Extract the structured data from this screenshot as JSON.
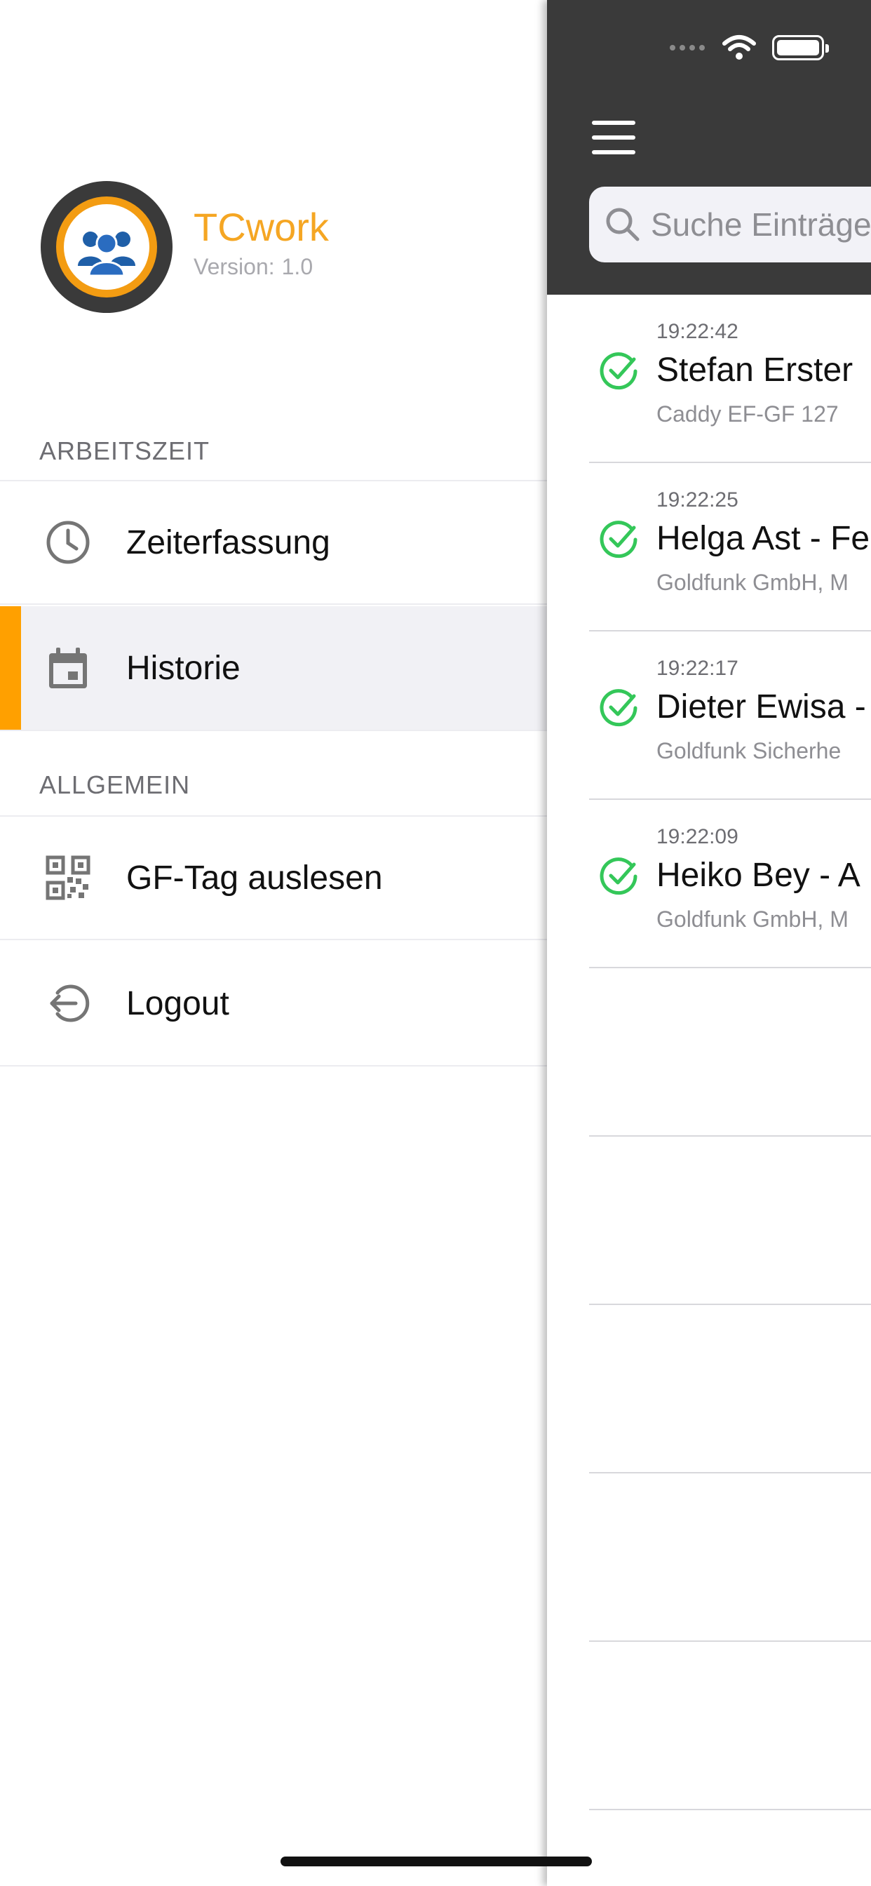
{
  "app": {
    "title": "TCwork",
    "version_label": "Version:",
    "version_value": "1.0",
    "accent_color": "#ffa000",
    "brand_color": "#f5a623"
  },
  "drawer": {
    "sections": [
      {
        "title": "ARBEITSZEIT",
        "items": [
          {
            "label": "Zeiterfassung",
            "icon": "clock-icon",
            "active": false
          },
          {
            "label": "Historie",
            "icon": "calendar-icon",
            "active": true
          }
        ]
      },
      {
        "title": "ALLGEMEIN",
        "items": [
          {
            "label": "GF-Tag auslesen",
            "icon": "qr-code-icon",
            "active": false
          },
          {
            "label": "Logout",
            "icon": "logout-icon",
            "active": false
          }
        ]
      }
    ]
  },
  "main": {
    "search_placeholder": "Suche Einträge",
    "entries": [
      {
        "time": "19:22:42",
        "name": "Stefan Erster",
        "sub": "Caddy EF-GF 127",
        "status": "check-icon"
      },
      {
        "time": "19:22:25",
        "name": "Helga Ast - Fe",
        "sub": "Goldfunk GmbH, M",
        "status": "check-icon"
      },
      {
        "time": "19:22:17",
        "name": "Dieter Ewisa -",
        "sub": "Goldfunk Sicherhe",
        "status": "check-icon"
      },
      {
        "time": "19:22:09",
        "name": "Heiko Bey - A",
        "sub": "Goldfunk GmbH, M",
        "status": "check-icon"
      }
    ],
    "status_color": "#34c759"
  }
}
